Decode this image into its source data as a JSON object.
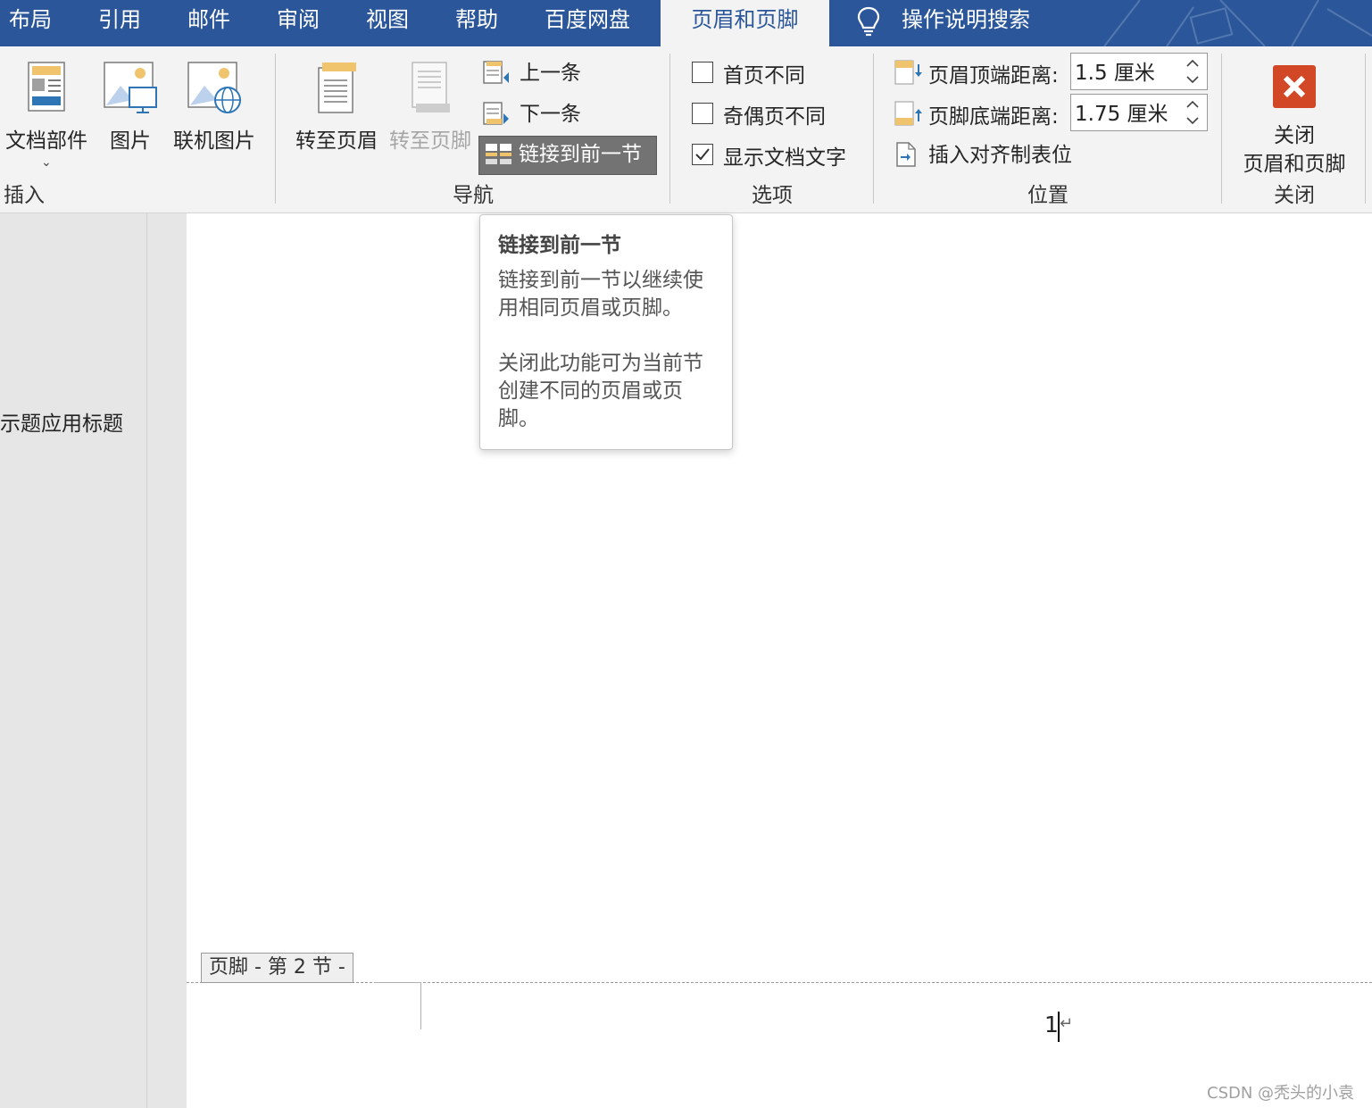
{
  "tabs": [
    {
      "label": "布局"
    },
    {
      "label": "引用"
    },
    {
      "label": "邮件"
    },
    {
      "label": "审阅"
    },
    {
      "label": "视图"
    },
    {
      "label": "帮助"
    },
    {
      "label": "百度网盘"
    },
    {
      "label": "页眉和页脚"
    }
  ],
  "search": {
    "label": "操作说明搜索"
  },
  "groups": {
    "insert": {
      "label": "插入",
      "doc_parts": "文档部件",
      "picture": "图片",
      "online_picture": "联机图片"
    },
    "navigation": {
      "label": "导航",
      "goto_header": "转至页眉",
      "goto_footer": "转至页脚",
      "previous": "上一条",
      "next": "下一条",
      "link_previous": "链接到前一节"
    },
    "options": {
      "label": "选项",
      "different_first": "首页不同",
      "different_odd_even": "奇偶页不同",
      "show_doc_text": "显示文档文字"
    },
    "position": {
      "label": "位置",
      "header_top_label": "页眉顶端距离:",
      "header_top_value": "1.5 厘米",
      "footer_bottom_label": "页脚底端距离:",
      "footer_bottom_value": "1.75 厘米",
      "insert_align_tab": "插入对齐制表位"
    },
    "close": {
      "label": "关闭",
      "close_btn_line1": "关闭",
      "close_btn_line2": "页眉和页脚"
    }
  },
  "checkboxes": {
    "different_first": false,
    "different_odd_even": false,
    "show_doc_text": true
  },
  "tooltip": {
    "title": "链接到前一节",
    "body1": "链接到前一节以继续使用相同页眉或页脚。",
    "body2": "关闭此功能可为当前节创建不同的页眉或页脚。"
  },
  "document": {
    "nav_pane_text": "示题应用标题",
    "footer_tag": "页脚 - 第 2 节 -",
    "page_number": "1"
  },
  "watermark": "CSDN @秃头的小袁",
  "colors": {
    "accent": "#2b579a",
    "close_red": "#d24726",
    "doc_orange": "#f0c36d"
  }
}
